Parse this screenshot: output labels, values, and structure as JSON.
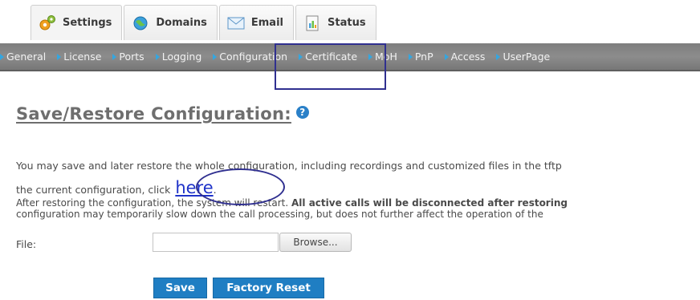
{
  "tabs": [
    {
      "label": "Settings",
      "icon": "settings-icon",
      "active": true
    },
    {
      "label": "Domains",
      "icon": "domains-icon"
    },
    {
      "label": "Email",
      "icon": "email-icon"
    },
    {
      "label": "Status",
      "icon": "status-icon"
    }
  ],
  "subnav": [
    "General",
    "License",
    "Ports",
    "Logging",
    "Configuration",
    "Certificate",
    "MoH",
    "PnP",
    "Access",
    "UserPage"
  ],
  "page": {
    "title": "Save/Restore Configuration:",
    "help_icon": "help-icon",
    "para1": "You may save and later restore the whole configuration, including recordings and customized files in the tftp",
    "line2_prefix": "the current configuration, click ",
    "here_link": "here",
    "line2_suffix": ".",
    "line3_normal": "After restoring the configuration, the system will restart. ",
    "line3_bold": "All active calls will be disconnected after restoring",
    "line4": "configuration may temporarily slow down the call processing, but does not further affect the operation of the"
  },
  "file": {
    "label": "File:",
    "value": "",
    "browse_label": "Browse..."
  },
  "actions": {
    "save_label": "Save",
    "reset_label": "Factory Reset"
  },
  "colors": {
    "accent": "#1f7ec3",
    "nav_bar": "#848484",
    "annotation": "#303090",
    "link": "#1f33c9"
  }
}
